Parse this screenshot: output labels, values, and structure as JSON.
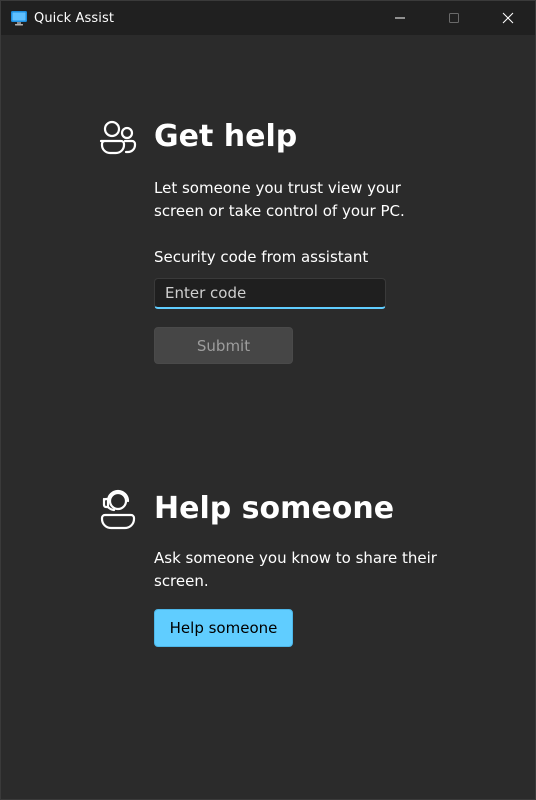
{
  "window": {
    "title": "Quick Assist",
    "app_icon": "monitor-icon",
    "controls": {
      "minimize_icon": "minimize-icon",
      "maximize_icon": "maximize-icon",
      "close_icon": "close-icon"
    }
  },
  "get_help": {
    "icon": "people-icon",
    "title": "Get help",
    "description": "Let someone you trust view your screen or take control of your PC.",
    "code_label": "Security code from assistant",
    "code_placeholder": "Enter code",
    "code_value": "",
    "submit_label": "Submit",
    "submit_enabled": false
  },
  "help_someone": {
    "icon": "person-headset-icon",
    "title": "Help someone",
    "description": "Ask someone you know to share their screen.",
    "button_label": "Help someone"
  },
  "colors": {
    "accent": "#60cdff",
    "background": "#2b2b2b",
    "titlebar": "#202020",
    "disabled_button": "#464646",
    "disabled_text": "#9d9d9d"
  }
}
